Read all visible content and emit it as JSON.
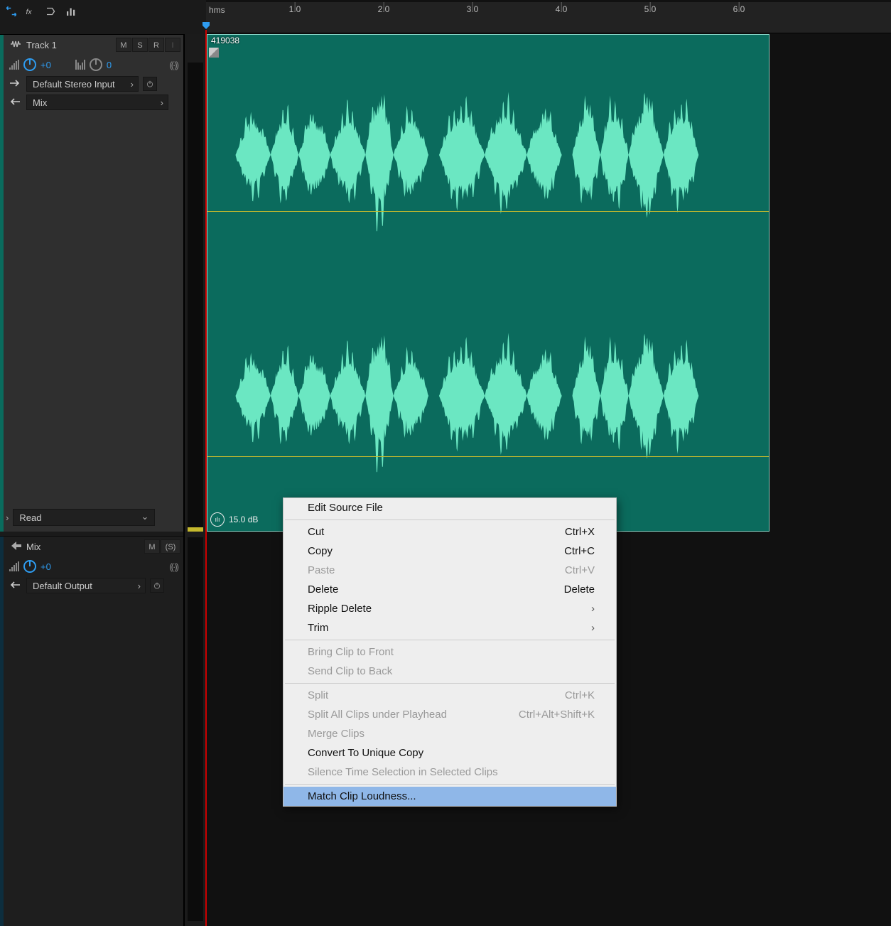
{
  "ruler": {
    "unit": "hms",
    "ticks": [
      "1.0",
      "2.0",
      "3.0",
      "4.0",
      "5.0",
      "6.0"
    ],
    "tickPositions": [
      125,
      250,
      375,
      500,
      625,
      750
    ]
  },
  "track": {
    "name": "Track 1",
    "btnM": "M",
    "btnS": "S",
    "btnR": "R",
    "btnI": "I",
    "volL": "+0",
    "volR": "0",
    "input": "Default Stereo Input",
    "output": "Mix",
    "automation": "Read"
  },
  "mix": {
    "name": "Mix",
    "btnM": "M",
    "btnS": "(S)",
    "vol": "+0",
    "output": "Default Output"
  },
  "clip": {
    "label": "419038",
    "badge": "15.0 dB"
  },
  "menu": {
    "editSource": "Edit Source File",
    "cut": "Cut",
    "cutK": "Ctrl+X",
    "copy": "Copy",
    "copyK": "Ctrl+C",
    "paste": "Paste",
    "pasteK": "Ctrl+V",
    "del": "Delete",
    "delK": "Delete",
    "ripple": "Ripple Delete",
    "trim": "Trim",
    "front": "Bring Clip to Front",
    "back": "Send Clip to Back",
    "split": "Split",
    "splitK": "Ctrl+K",
    "splitAll": "Split All Clips under Playhead",
    "splitAllK": "Ctrl+Alt+Shift+K",
    "merge": "Merge Clips",
    "unique": "Convert To Unique Copy",
    "silence": "Silence Time Selection in Selected Clips",
    "match": "Match Clip Loudness..."
  }
}
